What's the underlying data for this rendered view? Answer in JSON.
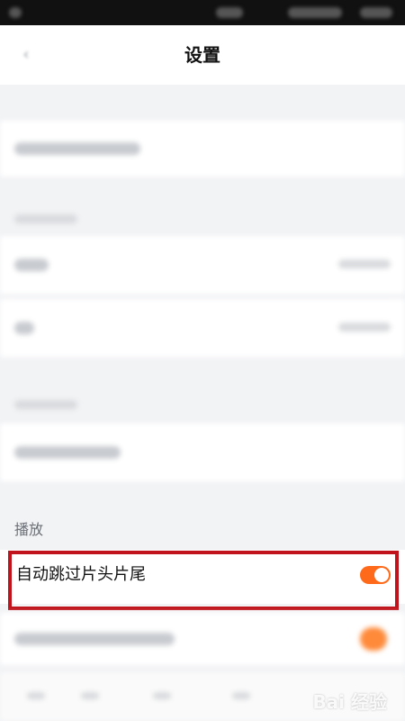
{
  "header": {
    "title": "设置",
    "back_icon": "chevron-left-icon"
  },
  "playback_section": {
    "label": "播放",
    "skip_intro_outro": {
      "label": "自动跳过片头片尾",
      "enabled": true
    }
  },
  "colors": {
    "accent": "#ff6a1a",
    "highlight_frame": "#c0131b"
  },
  "watermark": {
    "text": "Bai 经验"
  }
}
